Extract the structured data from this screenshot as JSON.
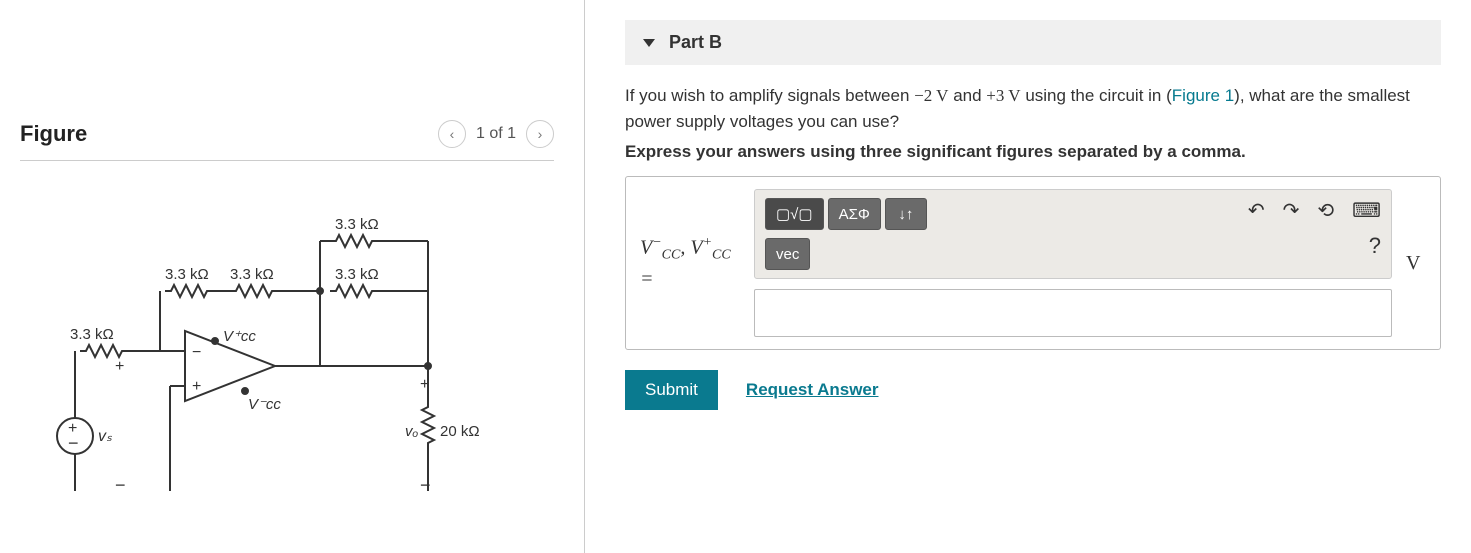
{
  "figure": {
    "title": "Figure",
    "counter": "1 of 1",
    "labels": {
      "r1": "3.3 kΩ",
      "r2": "3.3 kΩ",
      "r3": "3.3 kΩ",
      "r4": "3.3 kΩ",
      "r5": "3.3 kΩ",
      "rload": "20 kΩ",
      "vs": "vₛ",
      "vo": "vₒ",
      "vcc_plus": "V⁺cc",
      "vcc_minus": "V⁻cc"
    }
  },
  "part": {
    "title": "Part B",
    "question_pre": "If you wish to amplify signals between ",
    "val1": "−2 V",
    "question_mid": " and ",
    "val2": "+3 V",
    "question_post1": " using the circuit in (",
    "figure_link": "Figure 1",
    "question_post2": "), what are the smallest power supply voltages you can use?",
    "instruction": "Express your answers using three significant figures separated by a comma.",
    "var_label_html": "V⁻_CC, V⁺_CC =",
    "unit": "V",
    "toolbar": {
      "templates": "▢√▢",
      "greek": "ΑΣΦ",
      "updown": "↓↑",
      "vec": "vec",
      "undo": "↶",
      "redo": "↷",
      "reset": "⟲",
      "keyboard": "⌨",
      "help": "?"
    },
    "submit": "Submit",
    "request": "Request Answer"
  }
}
